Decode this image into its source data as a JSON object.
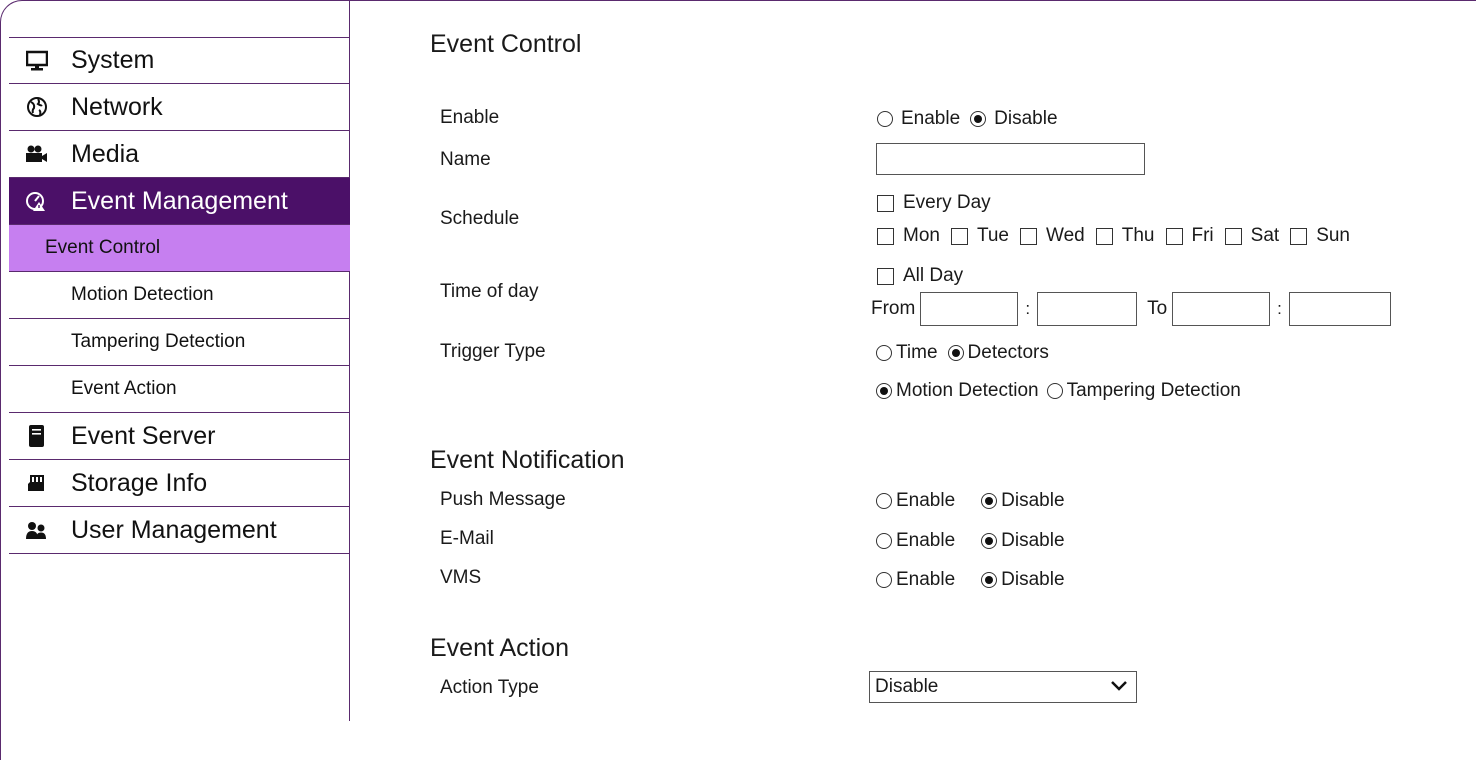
{
  "sidebar": {
    "items": [
      {
        "label": "System",
        "icon": "monitor-icon"
      },
      {
        "label": "Network",
        "icon": "globe-icon"
      },
      {
        "label": "Media",
        "icon": "video-camera-icon"
      },
      {
        "label": "Event Management",
        "icon": "event-alarm-icon"
      }
    ],
    "sub_items": [
      {
        "label": "Event Control"
      },
      {
        "label": "Motion Detection"
      },
      {
        "label": "Tampering Detection"
      },
      {
        "label": "Event Action"
      }
    ],
    "items_after": [
      {
        "label": "Event Server",
        "icon": "server-icon"
      },
      {
        "label": "Storage Info",
        "icon": "sd-card-icon"
      },
      {
        "label": "User Management",
        "icon": "users-icon"
      }
    ]
  },
  "event_control": {
    "title": "Event Control",
    "enable_label": "Enable",
    "enable_options": {
      "enable": "Enable",
      "disable": "Disable",
      "selected": "Disable"
    },
    "name_label": "Name",
    "name_value": "",
    "schedule_label": "Schedule",
    "every_day": "Every Day",
    "days": [
      "Mon",
      "Tue",
      "Wed",
      "Thu",
      "Fri",
      "Sat",
      "Sun"
    ],
    "time_label": "Time of day",
    "all_day": "All Day",
    "from_label": "From",
    "to_label": "To",
    "colon": ":",
    "trigger_label": "Trigger Type",
    "trigger_options": {
      "time": "Time",
      "detectors": "Detectors",
      "selected": "Detectors"
    },
    "detector_options": {
      "motion": "Motion Detection",
      "tampering": "Tampering Detection",
      "selected": "Motion Detection"
    }
  },
  "event_notification": {
    "title": "Event Notification",
    "rows": [
      {
        "label": "Push Message",
        "enable": "Enable",
        "disable": "Disable",
        "selected": "Disable"
      },
      {
        "label": "E-Mail",
        "enable": "Enable",
        "disable": "Disable",
        "selected": "Disable"
      },
      {
        "label": "VMS",
        "enable": "Enable",
        "disable": "Disable",
        "selected": "Disable"
      }
    ]
  },
  "event_action": {
    "title": "Event Action",
    "action_type_label": "Action Type",
    "action_type_value": "Disable"
  },
  "colors": {
    "border": "#5a2a6e",
    "active_nav": "#4b1068",
    "active_sub": "#c67ff0"
  }
}
